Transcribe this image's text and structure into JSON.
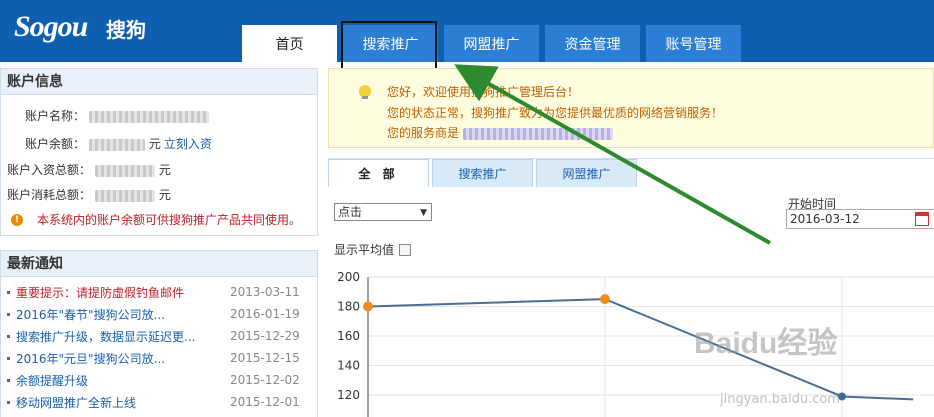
{
  "header": {
    "logo": "Sogou",
    "logo_cn": "搜狗",
    "tabs": [
      {
        "label": "首页",
        "active": true
      },
      {
        "label": "搜索推广",
        "active": false
      },
      {
        "label": "网盟推广",
        "active": false
      },
      {
        "label": "资金管理",
        "active": false
      },
      {
        "label": "账号管理",
        "active": false
      }
    ]
  },
  "account": {
    "title": "账户信息",
    "name_label": "账户名称：",
    "balance_label": "账户余额：",
    "balance_unit": "元",
    "recharge_link": "立刻入资",
    "total_in_label": "账户入资总额：",
    "total_in_unit": "元",
    "total_spend_label": "账户消耗总额：",
    "total_spend_unit": "元",
    "warning": "本系统内的账户余额可供搜狗推广产品共同使用。"
  },
  "news": {
    "title": "最新通知",
    "items": [
      {
        "title": "重要提示：请提防虚假钓鱼邮件",
        "date": "2013-03-11",
        "hot": true
      },
      {
        "title": "2016年\"春节\"搜狗公司放...",
        "date": "2016-01-19",
        "hot": false
      },
      {
        "title": "搜索推广升级，数据显示延迟更...",
        "date": "2015-12-29",
        "hot": false
      },
      {
        "title": "2016年\"元旦\"搜狗公司放...",
        "date": "2015-12-15",
        "hot": false
      },
      {
        "title": "余额提醒升级",
        "date": "2015-12-02",
        "hot": false
      },
      {
        "title": "移动网盟推广全新上线",
        "date": "2015-12-01",
        "hot": false
      }
    ]
  },
  "notice": {
    "line1": "您好，欢迎使用搜狗推广管理后台！",
    "line2": "您的状态正常，搜狗推广致力为您提供最优质的网络营销服务！",
    "line3": "您的服务商是"
  },
  "content": {
    "tabs": [
      "全 部",
      "搜索推广",
      "网盟推广"
    ],
    "metric_select": "点击",
    "show_avg_label": "显示平均值",
    "start_time_label": "开始时间",
    "start_date": "2016-03-12"
  },
  "chart_data": {
    "type": "line",
    "y_ticks": [
      120,
      140,
      160,
      180,
      200
    ],
    "ylim": [
      115,
      200
    ],
    "points": [
      {
        "x": 0,
        "y": 180
      },
      {
        "x": 1,
        "y": 185
      },
      {
        "x": 2,
        "y": 119
      },
      {
        "x": 2.3,
        "y": 117
      }
    ],
    "colors": {
      "line": "#4a6f94",
      "marker_orange": "#f08c20",
      "marker_blue": "#3d6a95"
    }
  },
  "watermark": {
    "brand": "Baidu经验",
    "url": "jingyan.baidu.com"
  }
}
